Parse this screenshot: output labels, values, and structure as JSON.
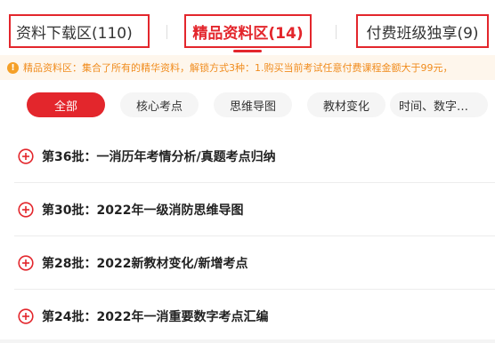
{
  "tabs": [
    {
      "label": "资料下载区(110)"
    },
    {
      "label": "精品资料区(14)"
    },
    {
      "label": "付费班级独享(9)"
    }
  ],
  "notice": {
    "icon": "info-icon",
    "text": "精品资料区：集合了所有的精华资料，解锁方式3种：1.购买当前考试任意付费课程金额大于99元，",
    "color": "#f08c1e"
  },
  "filters": [
    {
      "label": "全部"
    },
    {
      "label": "核心考点"
    },
    {
      "label": "思维导图"
    },
    {
      "label": "教材变化"
    },
    {
      "label": "时间、数字…"
    }
  ],
  "items": [
    {
      "title": "第36批：一消历年考情分析/真题考点归纳"
    },
    {
      "title": "第30批：2022年一级消防思维导图"
    },
    {
      "title": "第28批：2022新教材变化/新增考点"
    },
    {
      "title": "第24批：2022年一消重要数字考点汇编"
    }
  ],
  "colors": {
    "accent": "#e3262c",
    "notice_bg": "#fef6ec",
    "chip_bg": "#f5f5f5"
  }
}
